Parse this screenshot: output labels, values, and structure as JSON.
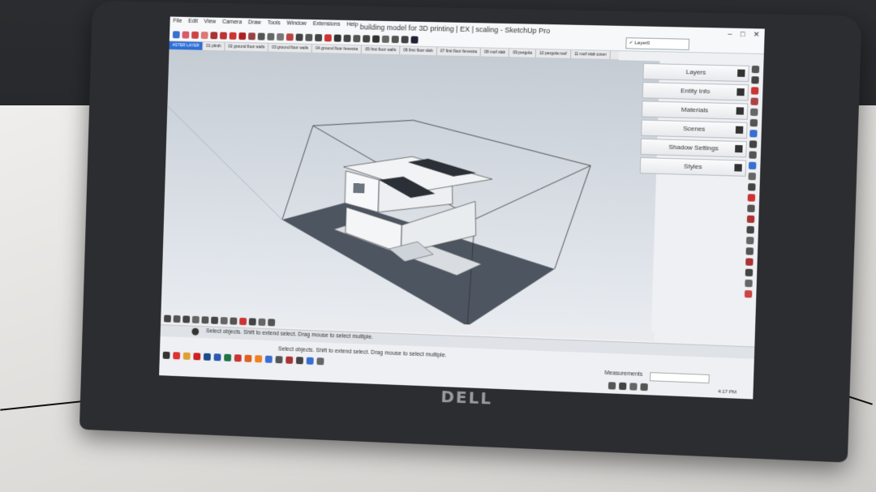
{
  "window": {
    "title": "building model for 3D printing | EX | scaling - SketchUp Pro",
    "controls": [
      "–",
      "□",
      "✕"
    ]
  },
  "menu": [
    "File",
    "Edit",
    "View",
    "Camera",
    "Draw",
    "Tools",
    "Window",
    "Extensions",
    "Help"
  ],
  "layer_select": {
    "check": "✓",
    "value": "Layer0"
  },
  "scene_tabs": [
    {
      "label": "ASTER LAYER",
      "active": true
    },
    {
      "label": "01 plinth",
      "active": false
    },
    {
      "label": "02 ground floor walls",
      "active": false
    },
    {
      "label": "03 ground floor walls",
      "active": false
    },
    {
      "label": "04 ground floor fenestra",
      "active": false
    },
    {
      "label": "05 first floor walls",
      "active": false
    },
    {
      "label": "06 first floor slab",
      "active": false
    },
    {
      "label": "07 first floor fenestra",
      "active": false
    },
    {
      "label": "08 roof slab",
      "active": false
    },
    {
      "label": "09 pergola",
      "active": false
    },
    {
      "label": "10 pergola roof",
      "active": false
    },
    {
      "label": "11 roof slab cover",
      "active": false
    }
  ],
  "trays": [
    "Layers",
    "Entity Info",
    "Materials",
    "Scenes",
    "Shadow Settings",
    "Styles"
  ],
  "status": {
    "hint_1": "Select objects. Shift to extend select. Drag mouse to select multiple.",
    "hint_2": "Select objects. Shift to extend select. Drag mouse to select multiple.",
    "measurements_label": "Measurements"
  },
  "clock": "4:17 PM",
  "brand": "DELL",
  "colors": {
    "active_tab": "#2f6fd6",
    "viewport_sky": "#c5ccd4",
    "shadow": "#4c5560",
    "bezel": "#2c2d30"
  }
}
